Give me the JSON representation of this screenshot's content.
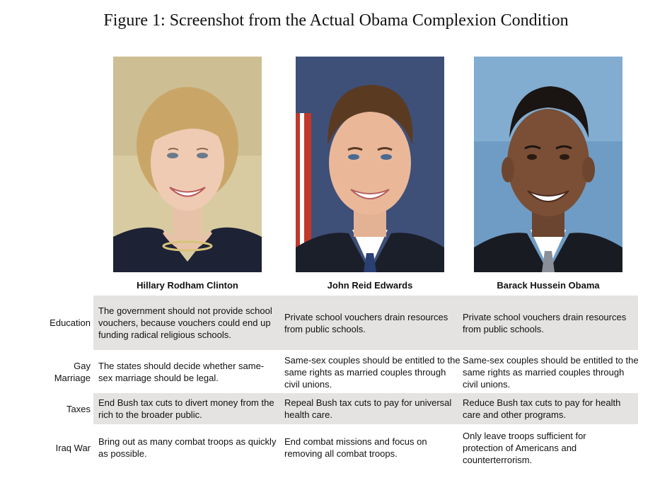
{
  "title": "Figure 1: Screenshot from the Actual Obama Complexion Condition",
  "candidates": [
    {
      "name": "Hillary Rodham Clinton"
    },
    {
      "name": "John Reid Edwards"
    },
    {
      "name": "Barack Hussein Obama"
    }
  ],
  "rows": [
    {
      "label": "Education",
      "cells": [
        "The government should not provide school vouchers, because vouchers could end up funding radical religious schools.",
        "Private school vouchers drain resources from public schools.",
        "Private school vouchers drain resources from public schools."
      ]
    },
    {
      "label": "Gay Marriage",
      "cells": [
        "The states should decide whether same-sex marriage should be legal.",
        "Same-sex couples should be entitled to the same rights as married couples through civil unions.",
        "Same-sex couples should be entitled to the same rights as married couples through civil unions."
      ]
    },
    {
      "label": "Taxes",
      "cells": [
        "End Bush tax cuts to divert money from the rich to the broader public.",
        "Repeal Bush tax cuts to pay for universal health care.",
        "Reduce Bush tax cuts to pay for health care and other programs."
      ]
    },
    {
      "label": "Iraq War",
      "cells": [
        "Bring out as many combat troops as quickly as possible.",
        "End combat missions and focus on removing all combat troops.",
        "Only leave troops sufficient for protection of Americans and counterterrorism."
      ]
    }
  ],
  "colors": {
    "band": "#e5e2e2",
    "text": "#111111"
  }
}
